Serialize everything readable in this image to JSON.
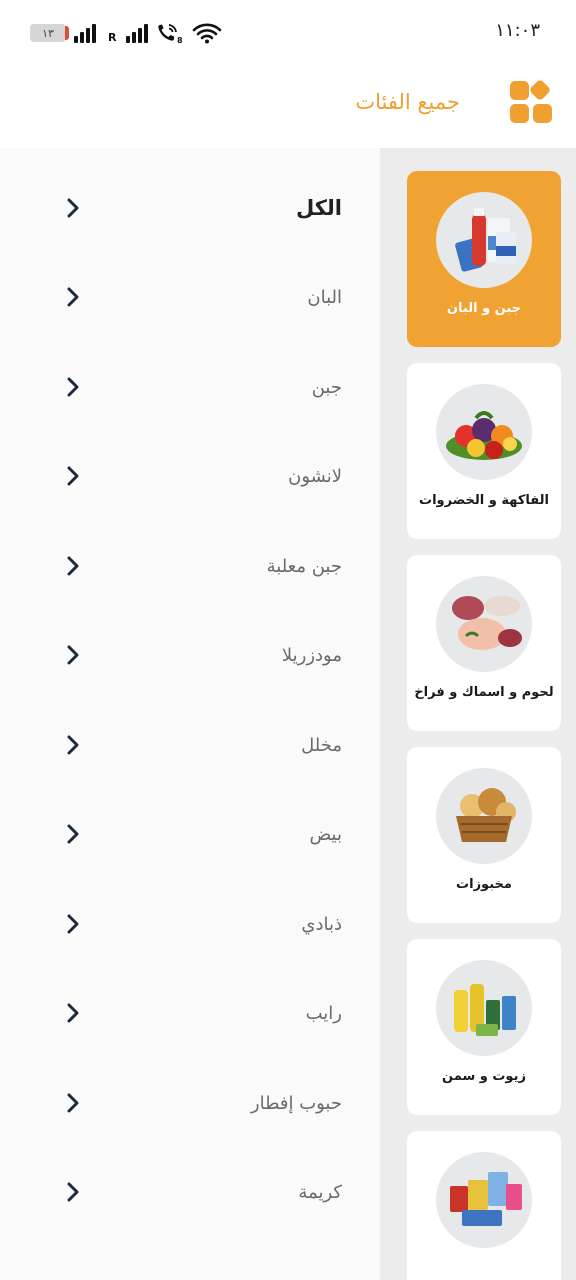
{
  "status_bar": {
    "time": "١١:٠٣",
    "battery": "١٣"
  },
  "header": {
    "title": "جميع الفئات",
    "icon": "grid-icon",
    "accent_color": "#f0a030"
  },
  "categories": [
    {
      "label": "جبن و البان",
      "active": true,
      "image": "dairy-products-image"
    },
    {
      "label": "الفاكهة و الخضروات",
      "active": false,
      "image": "fruits-vegetables-image"
    },
    {
      "label": "لحوم و اسماك و فراخ",
      "active": false,
      "image": "meat-fish-poultry-image"
    },
    {
      "label": "مخبوزات",
      "active": false,
      "image": "bakery-basket-image"
    },
    {
      "label": "زيوت و سمن",
      "active": false,
      "image": "oils-ghee-image"
    },
    {
      "label": "",
      "active": false,
      "image": "packaged-goods-image"
    }
  ],
  "subcategories": [
    {
      "label": "الكل"
    },
    {
      "label": "البان"
    },
    {
      "label": "جبن"
    },
    {
      "label": "لانشون"
    },
    {
      "label": "جبن معلبة"
    },
    {
      "label": "مودزريلا"
    },
    {
      "label": "مخلل"
    },
    {
      "label": "بيض"
    },
    {
      "label": "ذبادي"
    },
    {
      "label": "رايب"
    },
    {
      "label": "حبوب إفطار"
    },
    {
      "label": "كريمة"
    }
  ],
  "colors": {
    "active_card": "#f0a232",
    "chevron": "#1b2a3a"
  }
}
